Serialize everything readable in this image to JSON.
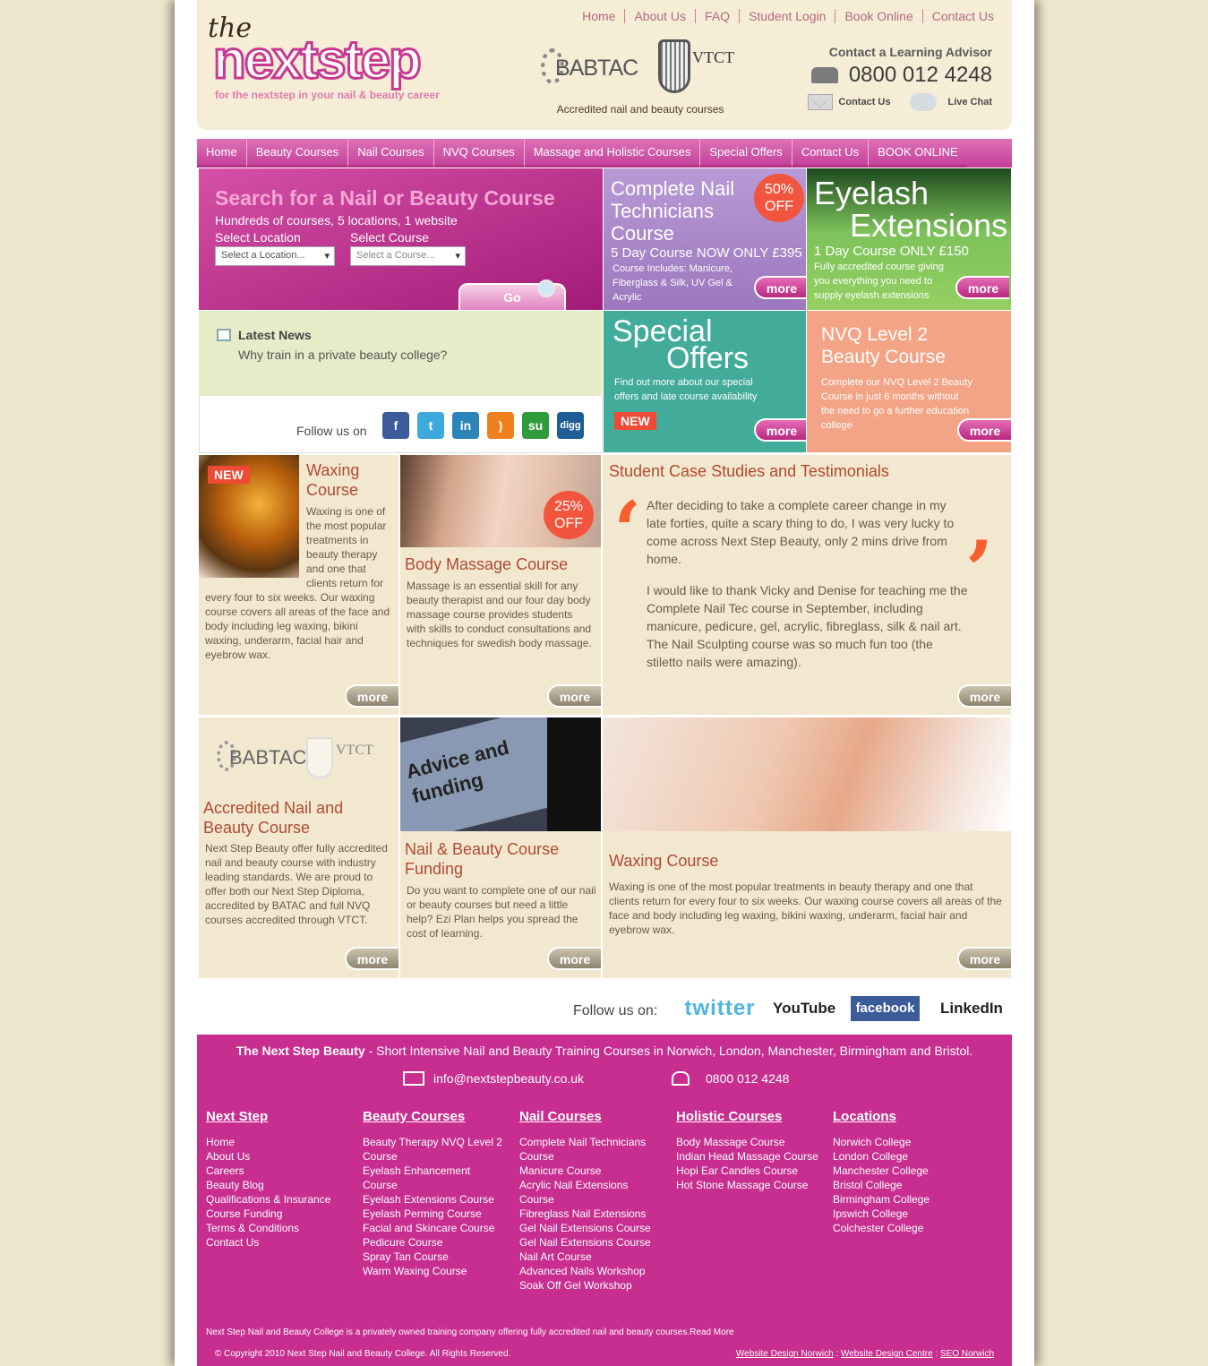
{
  "top_nav": [
    "Home",
    "About Us",
    "FAQ",
    "Student Login",
    "Book Online",
    "Contact Us"
  ],
  "logo": {
    "the": "the",
    "word": "nextstep",
    "tagline": "for the nextstep in your nail & beauty career"
  },
  "accreditation": {
    "babtac": "BABTAC",
    "vtct": "VTCT",
    "caption": "Accredited nail and beauty courses"
  },
  "contact": {
    "label": "Contact a Learning Advisor",
    "phone": "0800 012 4248",
    "contact_us": "Contact Us",
    "live_chat": "Live Chat"
  },
  "main_nav": [
    "Home",
    "Beauty Courses",
    "Nail Courses",
    "NVQ Courses",
    "Massage and Holistic Courses",
    "Special Offers",
    "Contact Us",
    "BOOK ONLINE"
  ],
  "search": {
    "title": "Search for a Nail or Beauty Course",
    "subtitle": "Hundreds of courses, 5 locations, 1 website",
    "location_label": "Select Location",
    "course_label": "Select Course",
    "location_value": "Select a Location...",
    "course_value": "Select a Course...",
    "go": "Go"
  },
  "promos": {
    "nail": {
      "title": "Complete Nail Technicians Course",
      "badge": "50% OFF",
      "price": "5 Day Course NOW ONLY £395",
      "includes": "Course Includes: Manicure, Fiberglass & Silk, UV Gel & Acrylic",
      "more": "more"
    },
    "eyelash": {
      "title1": "Eyelash",
      "title2": "Extensions",
      "price": "1 Day Course ONLY £150",
      "desc": "Fully accredited course giving you everything you need to supply eyelash extensions",
      "more": "more"
    },
    "offers": {
      "title1": "Special",
      "title2": "Offers",
      "desc": "Find out more about our special offers and late course availability",
      "badge": "NEW",
      "more": "more"
    },
    "nvq": {
      "title": "NVQ Level 2 Beauty Course",
      "desc": "Complete our NVQ Level 2 Beauty Course in just 6 months without the need to go a further education college",
      "more": "more"
    }
  },
  "news": {
    "heading": "Latest News",
    "item": "Why train in a private beauty college?"
  },
  "follow": {
    "label": "Follow us on",
    "icons": [
      "facebook-icon",
      "twitter-icon",
      "linkedin-icon",
      "rss-icon",
      "stumbleupon-icon",
      "digg-icon"
    ]
  },
  "cards": {
    "waxing": {
      "badge": "NEW",
      "title": "Waxing Course",
      "text1": "Waxing is one of the most popular treatments in beauty therapy and one that clients return for",
      "text2": "every four to six weeks. Our waxing course covers all areas of the face and body including leg waxing, bikini waxing, underarm, facial hair and eyebrow wax.",
      "more": "more"
    },
    "massage": {
      "badge": "25% OFF",
      "title": "Body Massage Course",
      "text": "Massage is an essential skill for any beauty therapist and our four day body massage course provides students with skills to conduct consultations and techniques for swedish body massage.",
      "more": "more"
    },
    "testimonial": {
      "title": "Student Case Studies and Testimonials",
      "p1": "After deciding to take a complete career change in my late forties, quite a scary thing to do, I was very lucky to come across Next Step Beauty, only 2 mins drive from home.",
      "p2": "I would like to thank Vicky and Denise for teaching me the Complete Nail Tec course in September, including manicure, pedicure, gel, acrylic, fibreglass, silk & nail art. The Nail Sculpting course was so much fun too (the stiletto nails were amazing).",
      "more": "more"
    },
    "accredited": {
      "title": "Accredited Nail and Beauty Course",
      "text": "Next Step Beauty offer fully accredited nail and beauty course with industry leading standards. We are proud to offer both our Next Step Diploma, accredited by BATAC and full NVQ courses accredited through VTCT.",
      "more": "more"
    },
    "funding": {
      "image_text": "Advice and funding",
      "title": "Nail & Beauty Course Funding",
      "text": "Do you want to complete one of our nail or beauty courses but need a little help? Ezi Plan helps you spread the cost of learning.",
      "more": "more"
    },
    "waxing2": {
      "title": "Waxing Course",
      "text": "Waxing is one of the most popular treatments in beauty therapy and one that clients return for every four to six weeks. Our waxing course covers all areas of the face and body including leg waxing, bikini waxing, underarm, facial hair and eyebrow wax.",
      "more": "more"
    }
  },
  "follow_row": {
    "label": "Follow us on:",
    "twitter": "twitter",
    "youtube": "YouTube",
    "facebook": "facebook",
    "linkedin": "LinkedIn"
  },
  "footer": {
    "brand": "The Next Step Beauty",
    "intro": " - Short Intensive Nail and Beauty Training Courses in Norwich, London, Manchester, Birmingham and Bristol.",
    "email": "info@nextstepbeauty.co.uk",
    "phone": "0800 012 4248",
    "columns": [
      {
        "title": "Next Step",
        "items": [
          "Home",
          "About Us",
          "Careers",
          "Beauty Blog",
          "Qualifications & Insurance",
          "Course Funding",
          "Terms & Conditions",
          "Contact Us"
        ]
      },
      {
        "title": "Beauty Courses",
        "items": [
          "Beauty Therapy NVQ Level 2 Course",
          "Eyelash Enhancement Course",
          "Eyelash Extensions Course",
          "Eyelash Perming Course",
          "Facial and Skincare Course",
          "Pedicure Course",
          "Spray Tan Course",
          "Warm Waxing Course"
        ]
      },
      {
        "title": "Nail Courses",
        "items": [
          "Complete Nail Technicians Course",
          "Manicure Course",
          "Acrylic Nail Extensions Course",
          "Fibreglass Nail Extensions",
          "Gel Nail Extensions Course",
          "Gel Nail Extensions Course",
          "Nail Art Course",
          "Advanced Nails Workshop",
          "Soak Off Gel Workshop"
        ]
      },
      {
        "title": "Holistic Courses",
        "items": [
          "Body Massage Course",
          "Indian Head Massage Course",
          "Hopi Ear Candles Course",
          "Hot Stone Massage Course"
        ]
      },
      {
        "title": "Locations",
        "items": [
          "Norwich College",
          "London College",
          "Manchester College",
          "Bristol College",
          "Birmingham College",
          "Ipswich College",
          "Colchester College"
        ]
      }
    ],
    "about": "Next Step Nail and Beauty College is a privately owned training company offering fully accredited nail and beauty courses.Read More",
    "copyright": "© Copyright 2010 Next Step Nail and Beauty College. All Rights Reserved.",
    "credit1": "Website Design Norwich",
    "credit2": "Website Design Centre",
    "credit3": "SEO Norwich"
  },
  "colors": {
    "brand_pink": "#c72e90",
    "cream": "#f2e8cf",
    "accent_orange": "#f2553d"
  }
}
